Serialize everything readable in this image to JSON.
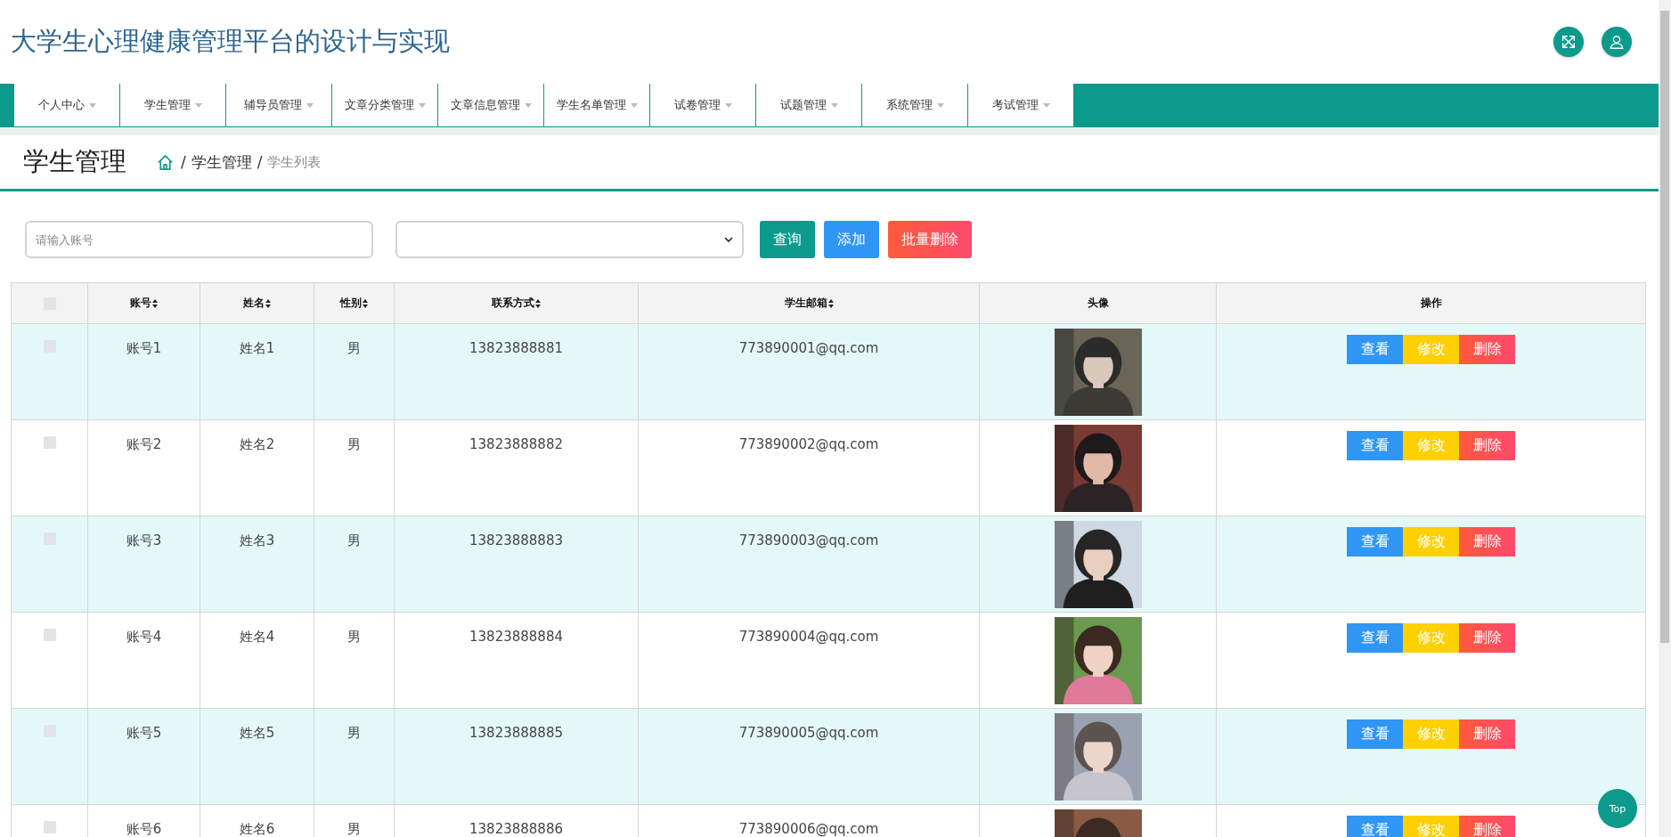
{
  "header": {
    "title": "大学生心理健康管理平台的设计与实现"
  },
  "nav": [
    {
      "label": "个人中心"
    },
    {
      "label": "学生管理"
    },
    {
      "label": "辅导员管理"
    },
    {
      "label": "文章分类管理"
    },
    {
      "label": "文章信息管理"
    },
    {
      "label": "学生名单管理"
    },
    {
      "label": "试卷管理"
    },
    {
      "label": "试题管理"
    },
    {
      "label": "系统管理"
    },
    {
      "label": "考试管理"
    }
  ],
  "page": {
    "title": "学生管理",
    "breadcrumb": [
      {
        "separator": "/",
        "label": "学生管理"
      },
      {
        "separator": "/",
        "label": "学生列表"
      }
    ]
  },
  "search": {
    "placeholder": "请输入账号"
  },
  "toolbar": {
    "buttons": [
      {
        "label": "查询",
        "kind": "query"
      },
      {
        "label": "添加",
        "kind": "add"
      },
      {
        "label": "批量删除",
        "kind": "delete"
      }
    ]
  },
  "table": {
    "header_checked": false,
    "columns": [
      {
        "label": "账号",
        "sortable": true
      },
      {
        "label": "姓名",
        "sortable": true
      },
      {
        "label": "性别",
        "sortable": true
      },
      {
        "label": "联系方式",
        "sortable": true
      },
      {
        "label": "学生邮箱",
        "sortable": true
      },
      {
        "label": "头像",
        "sortable": false
      },
      {
        "label": "操作",
        "sortable": false
      }
    ],
    "rows": [
      {
        "checked": false,
        "account": "账号1",
        "name": "姓名1",
        "gender": "男",
        "phone": "13823888881",
        "email": "773890001@qq.com",
        "actions": [
          "查看",
          "修改",
          "删除"
        ]
      },
      {
        "checked": false,
        "account": "账号2",
        "name": "姓名2",
        "gender": "男",
        "phone": "13823888882",
        "email": "773890002@qq.com",
        "actions": [
          "查看",
          "修改",
          "删除"
        ]
      },
      {
        "checked": false,
        "account": "账号3",
        "name": "姓名3",
        "gender": "男",
        "phone": "13823888883",
        "email": "773890003@qq.com",
        "actions": [
          "查看",
          "修改",
          "删除"
        ]
      },
      {
        "checked": false,
        "account": "账号4",
        "name": "姓名4",
        "gender": "男",
        "phone": "13823888884",
        "email": "773890004@qq.com",
        "actions": [
          "查看",
          "修改",
          "删除"
        ]
      },
      {
        "checked": false,
        "account": "账号5",
        "name": "姓名5",
        "gender": "男",
        "phone": "13823888885",
        "email": "773890005@qq.com",
        "actions": [
          "查看",
          "修改",
          "删除"
        ]
      },
      {
        "checked": false,
        "account": "账号6",
        "name": "姓名6",
        "gender": "男",
        "phone": "13823888886",
        "email": "773890006@qq.com",
        "actions": [
          "查看",
          "修改",
          "删除"
        ]
      }
    ]
  },
  "back_to_top": {
    "label": "Top"
  }
}
